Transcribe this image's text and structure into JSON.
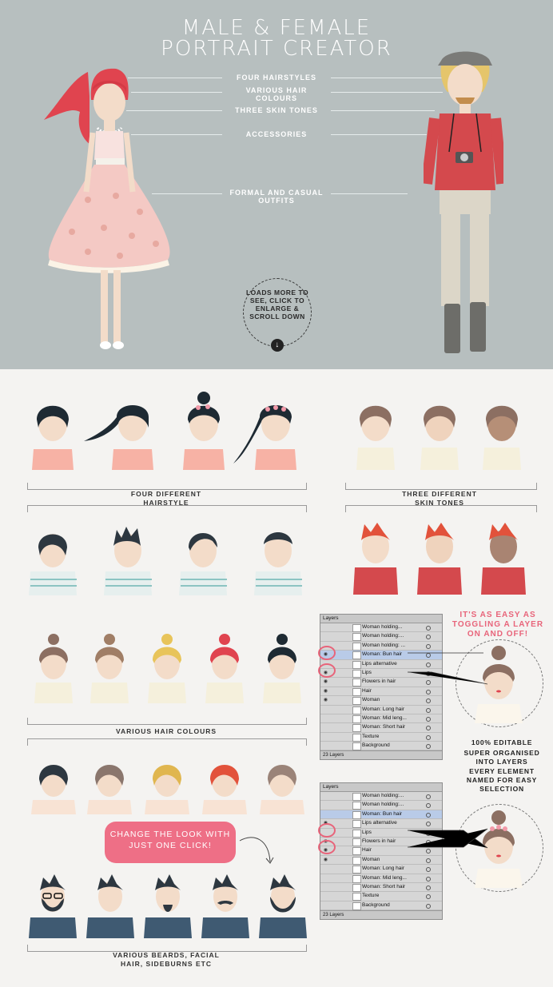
{
  "hero": {
    "title_line1": "MALE & FEMALE",
    "title_line2": "PORTRAIT CREATOR",
    "callouts": [
      "FOUR HAIRSTYLES",
      "VARIOUS HAIR COLOURS",
      "THREE SKIN TONES",
      "ACCESSORIES",
      "FORMAL AND CASUAL OUTFITS"
    ],
    "loads_text": "LOADS MORE TO SEE, CLICK TO ENLARGE & SCROLL DOWN",
    "loads_arrow": "↓"
  },
  "sections": {
    "hairstyle_label": "FOUR DIFFERENT HAIRSTYLE",
    "skin_label": "THREE DIFFERENT SKIN TONES",
    "hair_colours_label": "VARIOUS HAIR COLOURS",
    "beards_label": "VARIOUS BEARDS, FACIAL HAIR, SIDEBURNS ETC"
  },
  "notes": {
    "toggle": "IT'S AS EASY AS TOGGLING A LAYER ON AND OFF!",
    "editable": "100% EDITABLE",
    "organised": "SUPER ORGANISED INTO LAYERS",
    "named": "EVERY ELEMENT NAMED FOR EASY SELECTION",
    "change_look": "CHANGE THE LOOK WITH JUST ONE CLICK!"
  },
  "layers_panel_1": {
    "title": "Layers",
    "rows": [
      "Woman holding...",
      "Woman holding:...",
      "Woman holding: ...",
      "Woman: Bun hair",
      "Lips alternative",
      "Lips",
      "Flowers in hair",
      "Hair",
      "Woman",
      "Woman: Long hair",
      "Woman: Mid leng...",
      "Woman: Short hair",
      "Texture",
      "Background"
    ],
    "footer": "23 Layers"
  },
  "layers_panel_2": {
    "title": "Layers",
    "rows": [
      "Woman holding:...",
      "Woman holding:...",
      "Woman: Bun hair",
      "Lips alternative",
      "Lips",
      "Flowers in hair",
      "Hair",
      "Woman",
      "Woman: Long hair",
      "Woman: Mid leng...",
      "Woman: Short hair",
      "Texture",
      "Background"
    ],
    "footer": "23 Layers"
  },
  "colors": {
    "hero_bg": "#b7bfbf",
    "accent_pink": "#e8647a",
    "dress_pink": "#f4c9c4",
    "hair_red": "#e0444f",
    "shirt_red": "#d4494d"
  }
}
